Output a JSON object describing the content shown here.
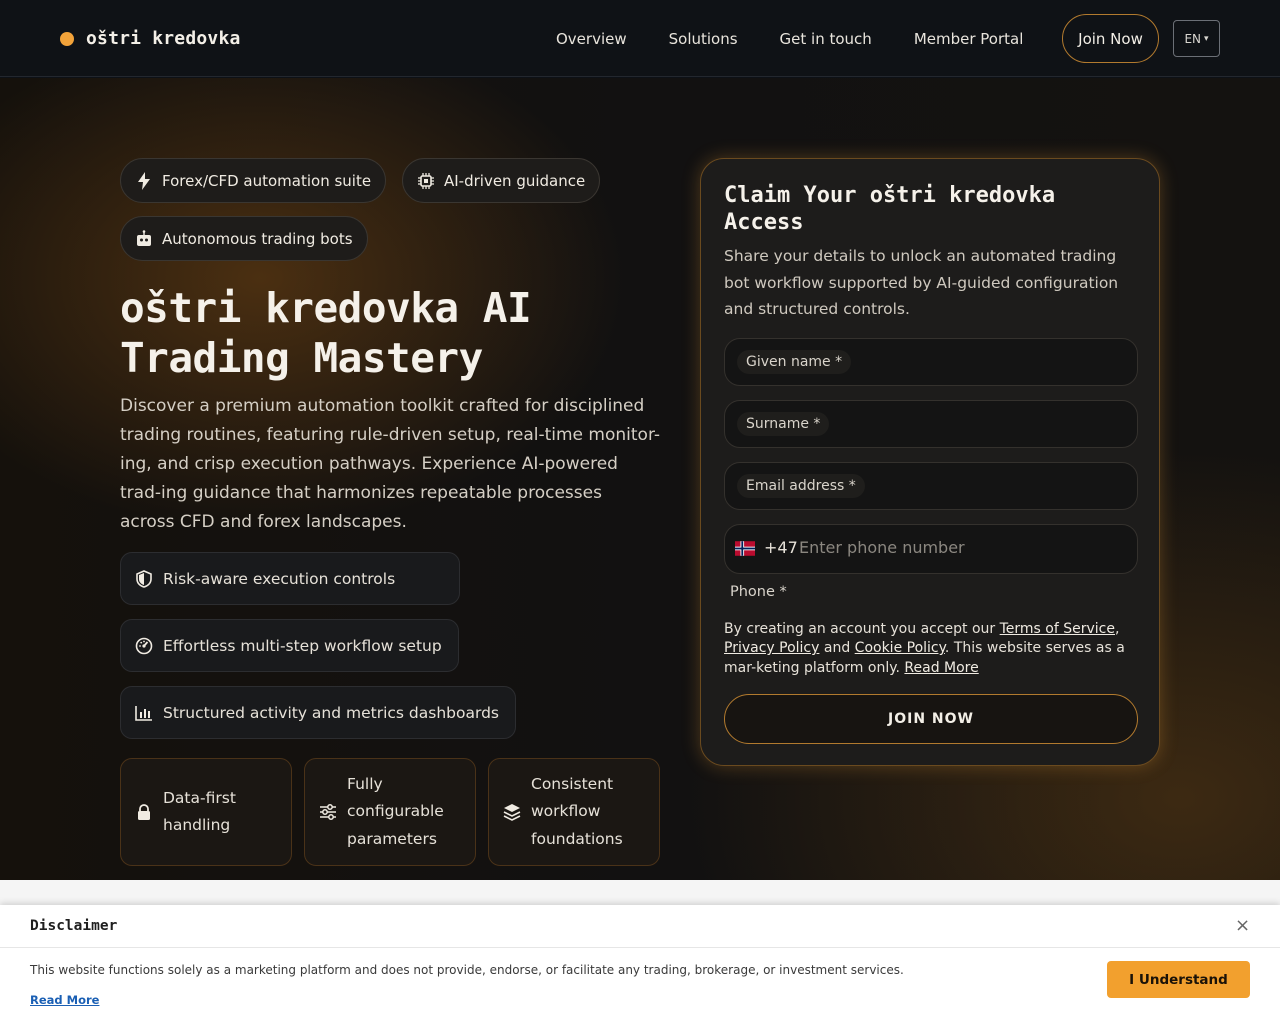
{
  "header": {
    "logo": "oštri kredovka",
    "nav": [
      "Overview",
      "Solutions",
      "Get in touch",
      "Member Portal"
    ],
    "join_label": "Join Now",
    "lang": "EN",
    "lang_caret": "▾",
    "accent_color": "#f2a33a"
  },
  "hero": {
    "chips": [
      {
        "label": "Forex/CFD automation suite",
        "icon": "lightning-icon"
      },
      {
        "label": "AI-driven guidance",
        "icon": "chip-icon"
      },
      {
        "label": "Autonomous trading bots",
        "icon": "robot-icon"
      }
    ],
    "title": "oštri kredovka AI Trading Mastery",
    "description": "Discover a premium automation toolkit crafted for disciplined trading routines, featuring rule-driven setup, real-time monitor-ing, and crisp execution pathways. Experience AI-powered trad-ing guidance that harmonizes repeatable processes across CFD and forex landscapes.",
    "features": [
      {
        "label": "Risk-aware execution controls",
        "icon": "shield-icon"
      },
      {
        "label": "Effortless multi-step workflow setup",
        "icon": "gauge-icon"
      },
      {
        "label": "Structured activity and metrics dashboards",
        "icon": "bar-chart-icon"
      }
    ],
    "boxes": [
      {
        "label": "Data-first handling",
        "icon": "lock-icon"
      },
      {
        "label": "Fully configurable parameters",
        "icon": "sliders-icon"
      },
      {
        "label": "Consistent workflow foundations",
        "icon": "layers-icon"
      }
    ]
  },
  "form": {
    "title": "Claim Your oštri kredovka Access",
    "description": "Share your details to unlock an automated trading bot workflow supported by AI-guided configuration and structured controls.",
    "given_name": "Given name *",
    "surname": "Surname *",
    "email": "Email address *",
    "country_code": "+47",
    "phone_placeholder": "Enter phone number",
    "phone_label": "Phone *",
    "terms_prefix": "By creating an account you accept our ",
    "terms_link": "Terms of Service",
    "terms_comma": ",",
    "privacy_link": "Privacy Policy",
    "and": " and ",
    "cookie_link": "Cookie Policy",
    "terms_suffix": ". This website serves as a mar-keting platform only. ",
    "read_more": "Read More",
    "submit": "JOIN NOW"
  },
  "disclaimer": {
    "title": "Disclaimer",
    "close": "×",
    "text": "This website functions solely as a marketing platform and does not provide, endorse, or facilitate any trading, brokerage, or investment services.",
    "read_more": "Read More",
    "button": "I Understand"
  }
}
